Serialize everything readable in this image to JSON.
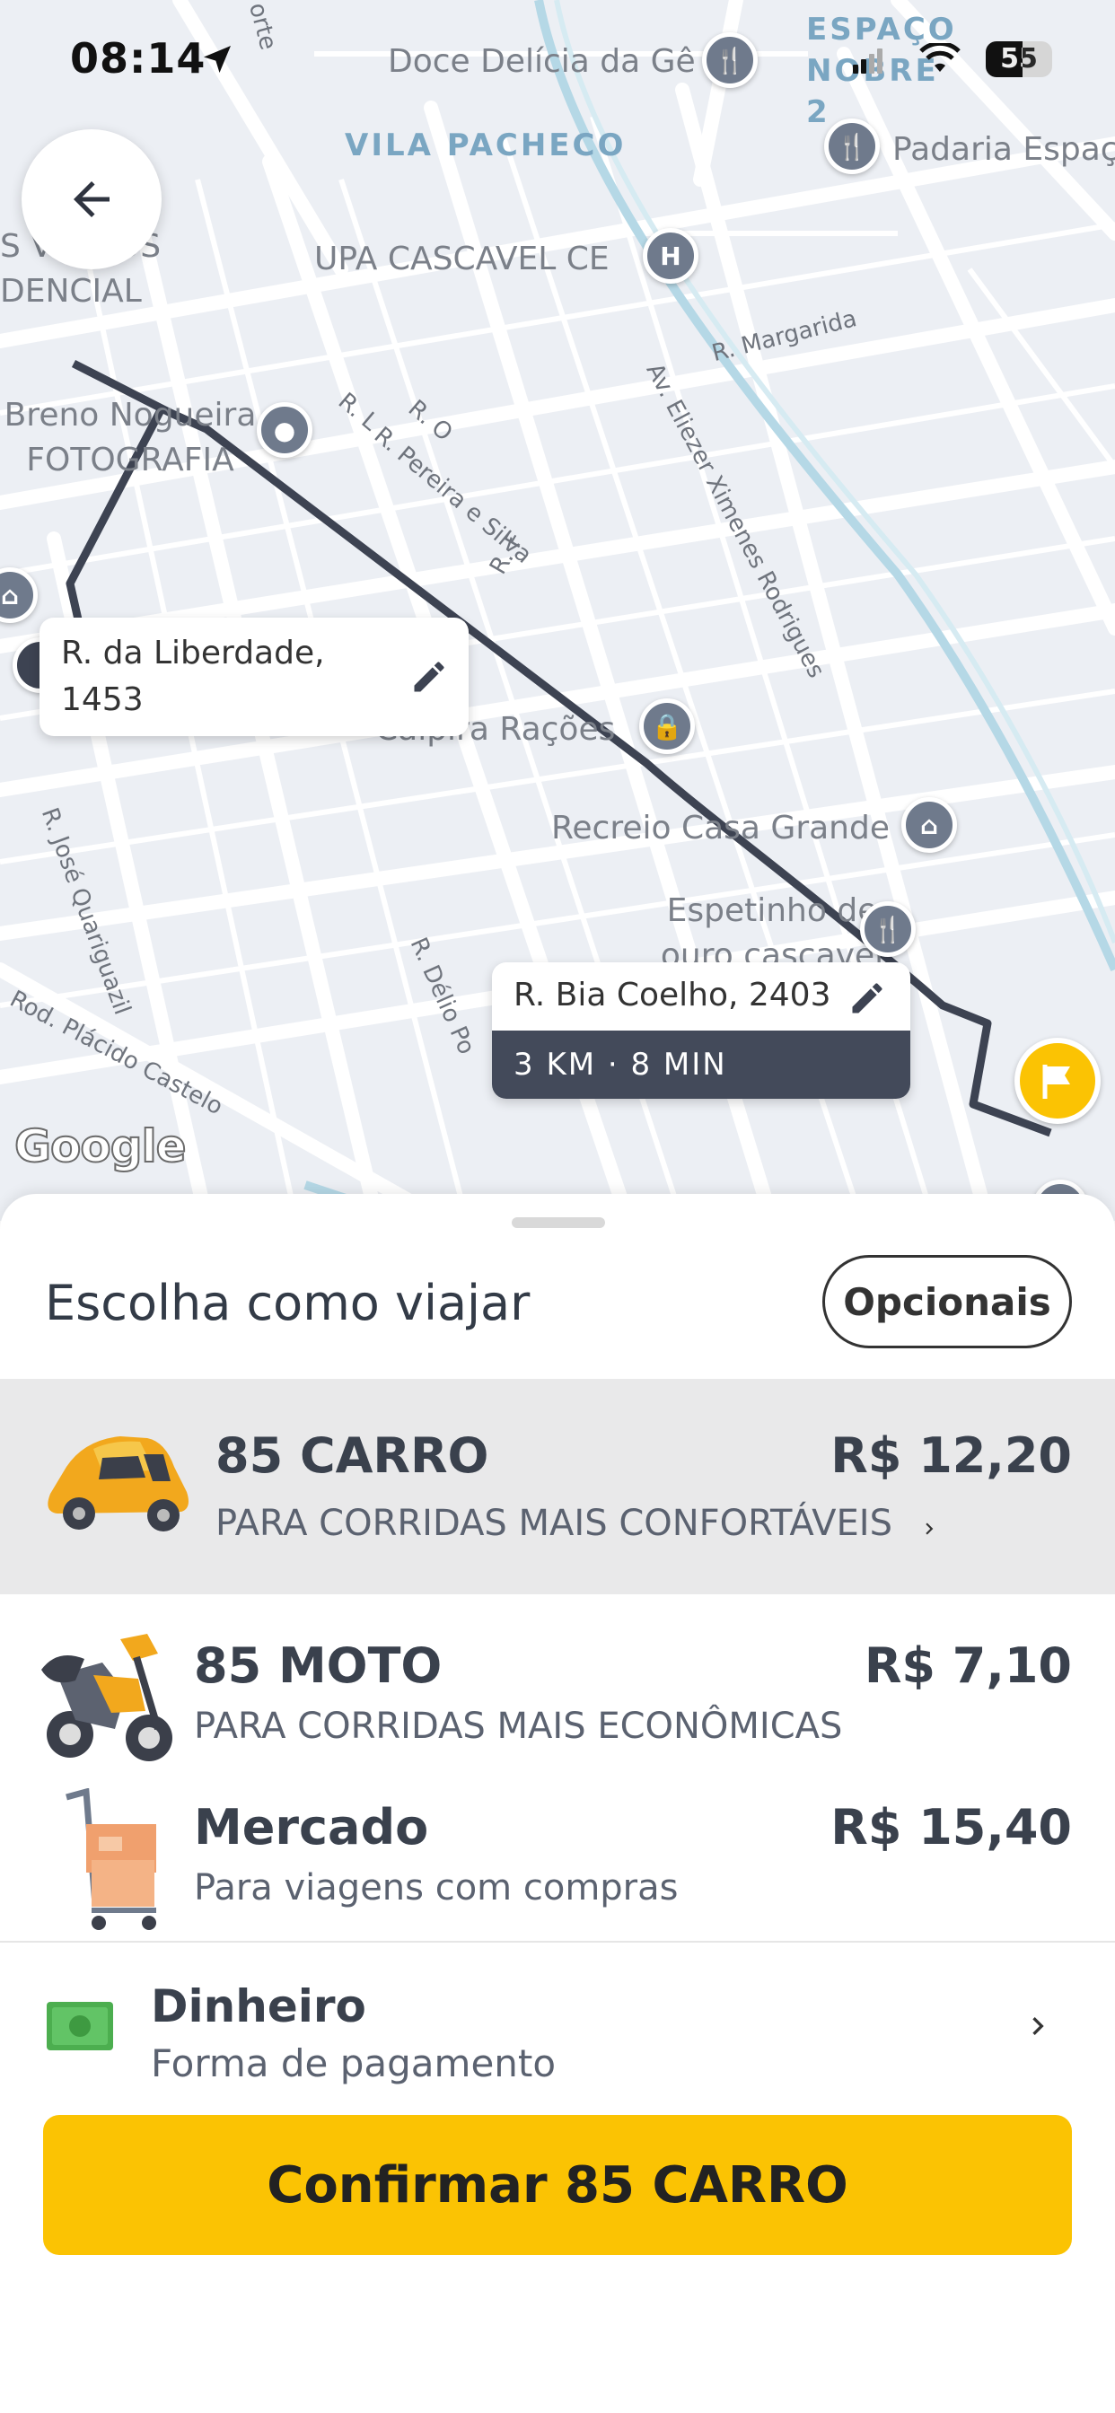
{
  "status_bar": {
    "time": "08:14",
    "battery": "55"
  },
  "map": {
    "districts": [
      "VILA PACHECO",
      "ESPAÇO NOBRE 2"
    ],
    "pois": [
      "Doce Delícia da Gê",
      "Padaria Espaç",
      "UPA CASCAVEL CE",
      "Breno Nogueira FOTOGRAFIA",
      "Caipira Rações",
      "Recreio Casa Grande",
      "Espetinho de ouro cascavel",
      "S VIEIROS DENCIAL"
    ],
    "streets": [
      "R. Margarida",
      "Av. Eliezer Ximenes Rodrigues",
      "R. Pereira e Silva",
      "R. O",
      "R. L",
      "R. F",
      "R. José Quariguazil",
      "R. Délio Po",
      "Rod. Plácido Castelo",
      "orte"
    ],
    "origin": "R. da Liberdade, 1453",
    "destination": "R. Bia Coelho, 2403",
    "eta": "3 KM · 8 MIN",
    "attribution": "Google"
  },
  "sheet": {
    "title": "Escolha como viajar",
    "options_button": "Opcionais",
    "rides": [
      {
        "name": "85 CARRO",
        "desc": "PARA CORRIDAS MAIS CONFORTÁVEIS",
        "price": "R$ 12,20",
        "selected": true,
        "icon": "car-icon"
      },
      {
        "name": "85 MOTO",
        "desc": "PARA CORRIDAS MAIS ECONÔMICAS",
        "price": "R$ 7,10",
        "selected": false,
        "icon": "motorcycle-icon"
      },
      {
        "name": "Mercado",
        "desc": "Para viagens com compras",
        "price": "R$ 15,40",
        "selected": false,
        "icon": "shopping-cart-icon"
      }
    ],
    "payment": {
      "title": "Dinheiro",
      "subtitle": "Forma de pagamento",
      "icon": "cash-icon"
    },
    "confirm_label": "Confirmar 85 CARRO"
  },
  "colors": {
    "accent": "#fbc303",
    "route": "#3d4352",
    "map_bg": "#eceff4"
  }
}
